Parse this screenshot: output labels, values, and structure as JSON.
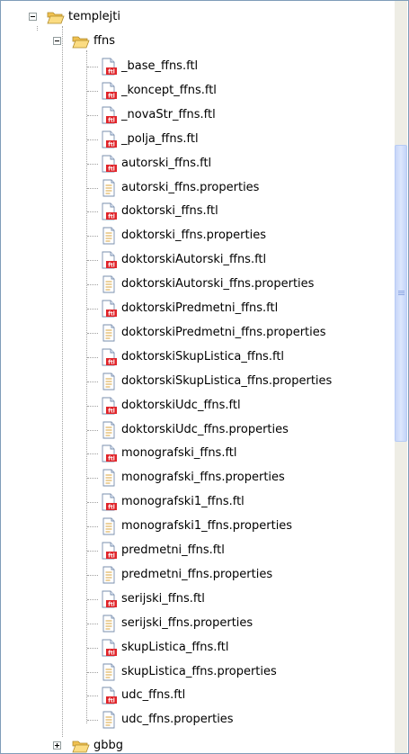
{
  "tree": {
    "root": {
      "label": "templejti",
      "expanded": true
    },
    "folder": {
      "label": "ffns",
      "expanded": true
    },
    "files": [
      {
        "label": "_base_ffns.ftl",
        "type": "ftl"
      },
      {
        "label": "_koncept_ffns.ftl",
        "type": "ftl"
      },
      {
        "label": "_novaStr_ffns.ftl",
        "type": "ftl"
      },
      {
        "label": "_polja_ffns.ftl",
        "type": "ftl"
      },
      {
        "label": "autorski_ffns.ftl",
        "type": "ftl"
      },
      {
        "label": "autorski_ffns.properties",
        "type": "properties"
      },
      {
        "label": "doktorski_ffns.ftl",
        "type": "ftl"
      },
      {
        "label": "doktorski_ffns.properties",
        "type": "properties"
      },
      {
        "label": "doktorskiAutorski_ffns.ftl",
        "type": "ftl"
      },
      {
        "label": "doktorskiAutorski_ffns.properties",
        "type": "properties"
      },
      {
        "label": "doktorskiPredmetni_ffns.ftl",
        "type": "ftl"
      },
      {
        "label": "doktorskiPredmetni_ffns.properties",
        "type": "properties"
      },
      {
        "label": "doktorskiSkupListica_ffns.ftl",
        "type": "ftl"
      },
      {
        "label": "doktorskiSkupListica_ffns.properties",
        "type": "properties"
      },
      {
        "label": "doktorskiUdc_ffns.ftl",
        "type": "ftl"
      },
      {
        "label": "doktorskiUdc_ffns.properties",
        "type": "properties"
      },
      {
        "label": "monografski_ffns.ftl",
        "type": "ftl"
      },
      {
        "label": "monografski_ffns.properties",
        "type": "properties"
      },
      {
        "label": "monografski1_ffns.ftl",
        "type": "ftl"
      },
      {
        "label": "monografski1_ffns.properties",
        "type": "properties"
      },
      {
        "label": "predmetni_ffns.ftl",
        "type": "ftl"
      },
      {
        "label": "predmetni_ffns.properties",
        "type": "properties"
      },
      {
        "label": "serijski_ffns.ftl",
        "type": "ftl"
      },
      {
        "label": "serijski_ffns.properties",
        "type": "properties"
      },
      {
        "label": "skupListica_ffns.ftl",
        "type": "ftl"
      },
      {
        "label": "skupListica_ffns.properties",
        "type": "properties"
      },
      {
        "label": "udc_ffns.ftl",
        "type": "ftl"
      },
      {
        "label": "udc_ffns.properties",
        "type": "properties"
      }
    ],
    "next_folder": {
      "label": "gbbg",
      "expanded": false
    }
  },
  "icons": {
    "folder": "open-folder-icon",
    "ftl": "ftl-template-file-icon",
    "properties": "properties-file-icon"
  },
  "colors": {
    "folder": "#f5c95a",
    "ftl_badge": "#e0242a",
    "tree_lines": "#a0a0a0",
    "scroll_thumb": "#c8d6f8"
  }
}
